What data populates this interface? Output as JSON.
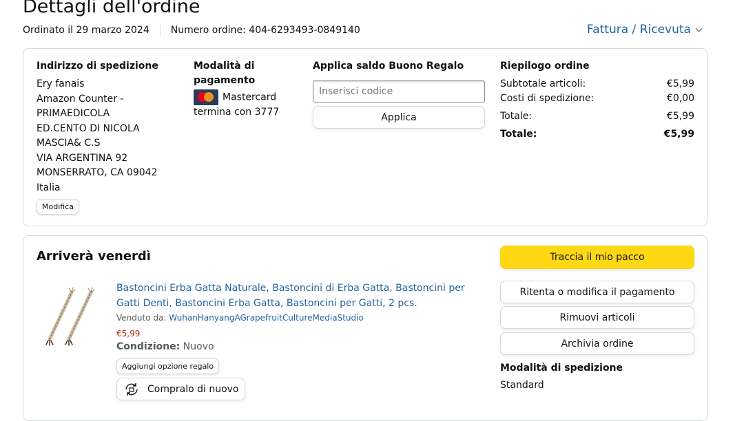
{
  "header": {
    "title": "Dettagli dell'ordine",
    "ordered_on": "Ordinato il 29 marzo 2024",
    "order_number": "Numero ordine: 404-6293493-0849140",
    "invoice_label": "Fattura / Ricevuta"
  },
  "shipping_address": {
    "heading": "Indirizzo di spedizione",
    "lines": [
      "Ery fanais",
      "Amazon Counter -",
      "PRIMAEDICOLA",
      "ED.CENTO DI NICOLA",
      "MASCIA& C.S",
      "VIA ARGENTINA 92",
      "MONSERRATO, CA 09042",
      "Italia"
    ],
    "edit_label": "Modifica"
  },
  "payment": {
    "heading_line1": "Modalità di",
    "heading_line2": "pagamento",
    "card_brand": "Mastercard",
    "card_ending": "termina con 3777"
  },
  "gift": {
    "heading": "Applica saldo Buono Regalo",
    "placeholder": "Inserisci codice",
    "apply_label": "Applica"
  },
  "summary": {
    "heading": "Riepilogo ordine",
    "rows": [
      {
        "label": "Subtotale articoli:",
        "value": "€5,99"
      },
      {
        "label": "Costi di spedizione:",
        "value": "€0,00"
      },
      {
        "label": "Totale:",
        "value": "€5,99"
      }
    ],
    "grand_total_label": "Totale:",
    "grand_total_value": "€5,99"
  },
  "shipment": {
    "arrival": "Arriverà venerdì",
    "product_title": "Bastoncini Erba Gatta Naturale, Bastoncini di Erba Gatta, Bastoncini per Gatti Denti, Bastoncini Erba Gatta, Bastoncini per Gatti, 2 pcs.",
    "sold_by_label": "Venduto da:",
    "seller": "WuhanHanyangAGrapefruitCultureMediaStudio",
    "price": "€5,99",
    "condition_label": "Condizione:",
    "condition_value": "Nuovo",
    "gift_option_label": "Aggiungi opzione regalo",
    "buy_again_label": "Compralo di nuovo"
  },
  "actions": {
    "track": "Traccia il mio pacco",
    "retry_payment": "Ritenta o modifica il pagamento",
    "remove_items": "Rimuovi articoli",
    "archive": "Archivia ordine",
    "shipping_method_heading": "Modalità di spedizione",
    "shipping_method_value": "Standard"
  },
  "colors": {
    "link": "#2162a1",
    "price": "#b12704",
    "track_button": "#ffd814"
  }
}
